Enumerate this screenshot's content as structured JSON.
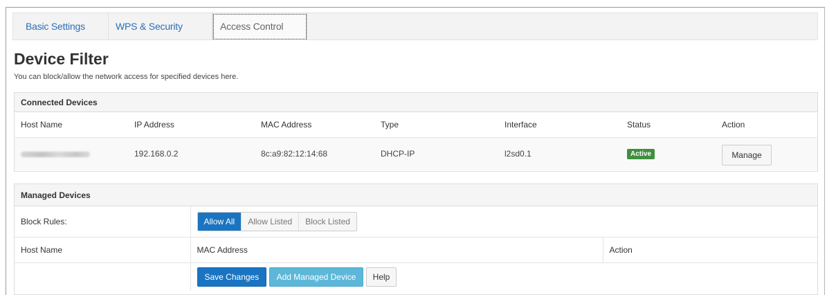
{
  "tabs": [
    {
      "label": "Basic Settings"
    },
    {
      "label": "WPS & Security"
    },
    {
      "label": "Access Control"
    }
  ],
  "page": {
    "title": "Device Filter",
    "subtitle": "You can block/allow the network access for specified devices here."
  },
  "connected": {
    "heading": "Connected Devices",
    "columns": [
      "Host Name",
      "IP Address",
      "MAC Address",
      "Type",
      "Interface",
      "Status",
      "Action"
    ],
    "rows": [
      {
        "ip": "192.168.0.2",
        "mac": "8c:a9:82:12:14:68",
        "type": "DHCP-IP",
        "interface": "l2sd0.1",
        "status": "Active",
        "action": "Manage"
      }
    ]
  },
  "managed": {
    "heading": "Managed Devices",
    "block_rules_label": "Block Rules:",
    "block_rules_options": [
      "Allow All",
      "Allow Listed",
      "Block Listed"
    ],
    "block_rules_selected": "Allow All",
    "columns": [
      "Host Name",
      "MAC Address",
      "Action"
    ],
    "buttons": {
      "save": "Save Changes",
      "add": "Add Managed Device",
      "help": "Help"
    }
  },
  "colors": {
    "link": "#2a6fb6",
    "primary": "#1a74c2",
    "info": "#5cb7d9",
    "active_badge": "#3f8f3f"
  }
}
